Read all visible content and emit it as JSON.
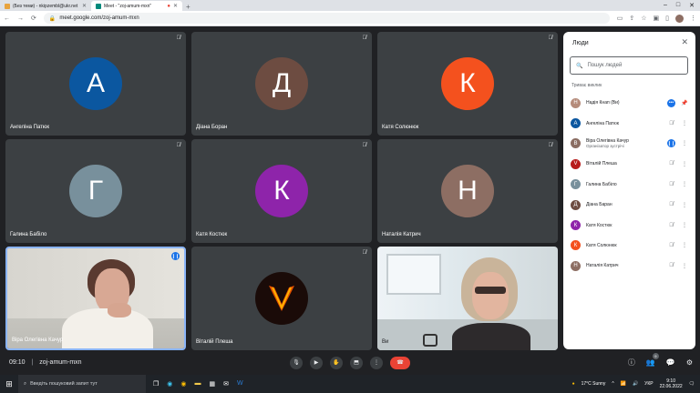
{
  "browser": {
    "tabs": [
      {
        "label": "(Без теми) - nkipzembl@ukr.net",
        "color": "#e8a33d",
        "active": false
      },
      {
        "label": "Meet - \"zoj-amum-mxn\"",
        "color": "#00897b",
        "active": true
      }
    ],
    "url": "meet.google.com/zoj-amum-mxn"
  },
  "tiles": [
    {
      "name": "Ангеліна Патюк",
      "initial": "А",
      "color": "#0b57a0"
    },
    {
      "name": "Діана Боран",
      "initial": "Д",
      "color": "#6d4c41"
    },
    {
      "name": "Катя Солюнюк",
      "initial": "К",
      "color": "#f4511e"
    },
    {
      "name": "Галина Бабіло",
      "initial": "Г",
      "color": "#78909c"
    },
    {
      "name": "Катя Костюк",
      "initial": "К",
      "color": "#8e24aa"
    },
    {
      "name": "Наталія Катрич",
      "initial": "Н",
      "color": "#8d6e63"
    },
    {
      "name": "Віра Олегівна Качур"
    },
    {
      "name": "Віталій Плеша"
    },
    {
      "name": "Ви"
    }
  ],
  "people_panel": {
    "title": "Люди",
    "search_placeholder": "Пошук людей",
    "section": "Триває виклик",
    "people": [
      {
        "name": "Надія Кнап (Ви)",
        "initial": "Н",
        "color": "#b58b7a",
        "role": ""
      },
      {
        "name": "Ангеліна Патюк",
        "initial": "А",
        "color": "#0b57a0",
        "role": ""
      },
      {
        "name": "Віра Олегівна Качур",
        "initial": "В",
        "color": "#8a6d62",
        "role": "Організатор зустрічі"
      },
      {
        "name": "Віталій Плеша",
        "initial": "V",
        "color": "#b71c1c",
        "role": ""
      },
      {
        "name": "Галина Бабіло",
        "initial": "Г",
        "color": "#78909c",
        "role": ""
      },
      {
        "name": "Діана Баран",
        "initial": "Д",
        "color": "#6d4c41",
        "role": ""
      },
      {
        "name": "Катя Костюк",
        "initial": "К",
        "color": "#8e24aa",
        "role": ""
      },
      {
        "name": "Катя Солюнюк",
        "initial": "К",
        "color": "#f4511e",
        "role": ""
      },
      {
        "name": "Наталія Катрич",
        "initial": "Н",
        "color": "#8d6e63",
        "role": ""
      }
    ]
  },
  "bottom_bar": {
    "time": "09:10",
    "separator": "|",
    "meeting_code": "zoj-amum-mxn",
    "participant_count": "9"
  },
  "taskbar": {
    "search_placeholder": "Введіть пошуковий запит тут",
    "weather": "17°C Sunny",
    "language": "УКР",
    "time": "9:10",
    "date": "22.06.2022"
  }
}
